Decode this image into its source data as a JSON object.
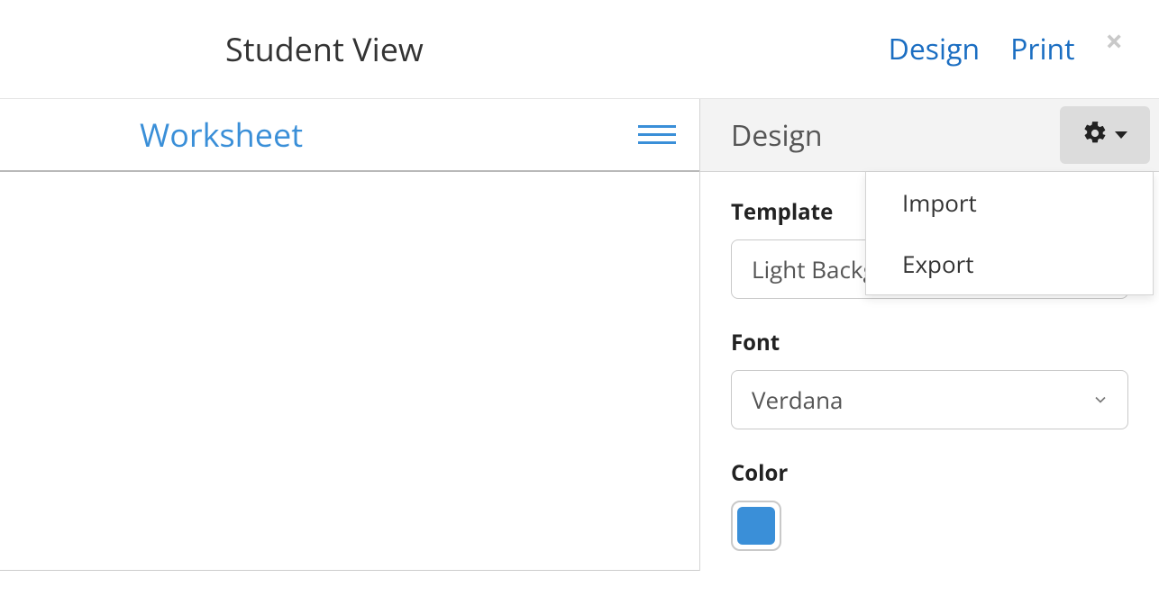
{
  "header": {
    "title": "Student View",
    "design_link": "Design",
    "print_link": "Print"
  },
  "worksheet": {
    "title": "Worksheet"
  },
  "panel": {
    "title": "Design",
    "template_label": "Template",
    "template_value": "Light Background",
    "font_label": "Font",
    "font_value": "Verdana",
    "color_label": "Color",
    "color_value": "#3a8fd8"
  },
  "gear_menu": {
    "items": [
      "Import",
      "Export"
    ]
  }
}
